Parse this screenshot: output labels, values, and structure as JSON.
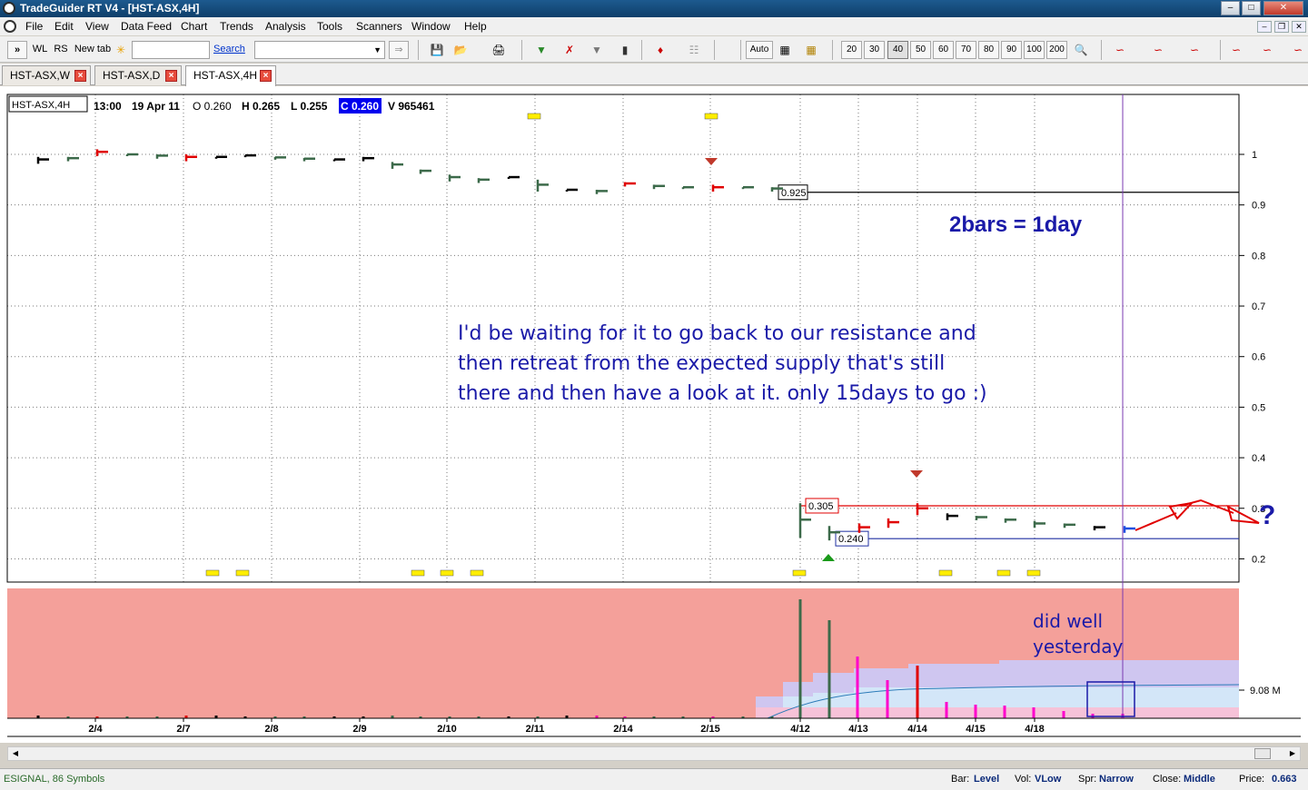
{
  "window": {
    "title": "TradeGuider RT V4  -  [HST-ASX,4H]"
  },
  "menu": [
    "File",
    "Edit",
    "View",
    "Data Feed",
    "Chart",
    "Trends",
    "Analysis",
    "Tools",
    "Scanners",
    "Window",
    "Help"
  ],
  "toolbar": {
    "wl": "WL",
    "rs": "RS",
    "new_tab": "New tab",
    "search_link": "Search",
    "auto": "Auto",
    "zoom_values": [
      "20",
      "30",
      "40",
      "50",
      "60",
      "70",
      "80",
      "90",
      "100",
      "200"
    ],
    "zoom_selected": "40"
  },
  "tabs": [
    {
      "label": "HST-ASX,W",
      "active": false
    },
    {
      "label": "HST-ASX,D",
      "active": false
    },
    {
      "label": "HST-ASX,4H",
      "active": true
    }
  ],
  "info": {
    "symbol": "HST-ASX,4H",
    "time": "13:00",
    "date": "19 Apr 11",
    "open": "O 0.260",
    "high": "H 0.265",
    "low": "L 0.255",
    "close": "C 0.260",
    "volume": "V 965461"
  },
  "chart_data": {
    "type": "bar",
    "price_axis": {
      "ticks": [
        "1",
        "0.9",
        "0.8",
        "0.7",
        "0.6",
        "0.5",
        "0.4",
        "0.3",
        "0.2"
      ]
    },
    "x_axis": {
      "ticks": [
        "2/4",
        "2/7",
        "2/8",
        "2/9",
        "2/10",
        "2/11",
        "2/14",
        "2/15",
        "4/12",
        "4/13",
        "4/14",
        "4/15",
        "4/18"
      ]
    },
    "volume_axis_label": "9.08 M",
    "levels": [
      {
        "label": "0.925",
        "value": 0.925,
        "color": "#000000"
      },
      {
        "label": "0.305",
        "value": 0.305,
        "color": "#e00000"
      },
      {
        "label": "0.240",
        "value": 0.24,
        "color": "#1f2fa0"
      }
    ],
    "colors": {
      "up_bar": "#e00000",
      "down_bar": "#3c6a4a",
      "neutral_bar": "#000000",
      "latest_bar": "#1f4fe0",
      "annotation": "#1a1aa8",
      "volume_bg": "#f4a09a"
    }
  },
  "annotations": {
    "headline": "2bars = 1day",
    "comment_line1": "I'd be waiting for it to go back to our resistance and",
    "comment_line2": "then retreat from the expected supply that's still",
    "comment_line3": "there and then have a look at it. only 15days to go :)",
    "volume_note_line1": "did well",
    "volume_note_line2": "yesterday",
    "question_mark": "?"
  },
  "status": {
    "feed": "ESIGNAL, 86 Symbols",
    "bar_label": "Bar:",
    "bar_value": "Level",
    "vol_label": "Vol:",
    "vol_value": "VLow",
    "spr_label": "Spr:",
    "spr_value": "Narrow",
    "close_label": "Close:",
    "close_value": "Middle",
    "price_label": "Price:",
    "price_value": "0.663"
  }
}
